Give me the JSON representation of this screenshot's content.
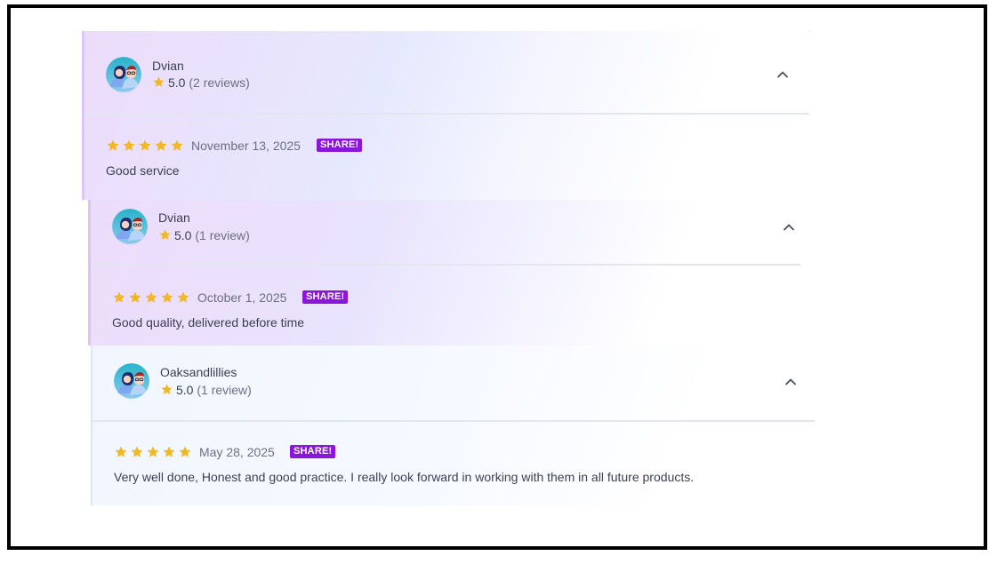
{
  "reviews": [
    {
      "reviewer": "Dvian",
      "rating": "5.0",
      "review_count": "(2 reviews)",
      "stars": 5,
      "date": "November 13, 2025",
      "badge": "SHARE!",
      "text": "Good service",
      "expanded": true
    },
    {
      "reviewer": "Dvian",
      "rating": "5.0",
      "review_count": "(1 review)",
      "stars": 5,
      "date": "October 1, 2025",
      "badge": "SHARE!",
      "text": "Good quality, delivered before time",
      "expanded": true
    },
    {
      "reviewer": "Oaksandlillies",
      "rating": "5.0",
      "review_count": "(1 review)",
      "stars": 5,
      "date": "May 28, 2025",
      "badge": "SHARE!",
      "text": "Very well done, Honest and good practice. I really look forward in working with them in all future products.",
      "expanded": true
    }
  ],
  "icons": {
    "star": "star-icon",
    "avatar": "avatar-icon",
    "collapse": "chevron-up-icon"
  },
  "colors": {
    "star": "#f2b824",
    "badge": "#8a17d8"
  }
}
